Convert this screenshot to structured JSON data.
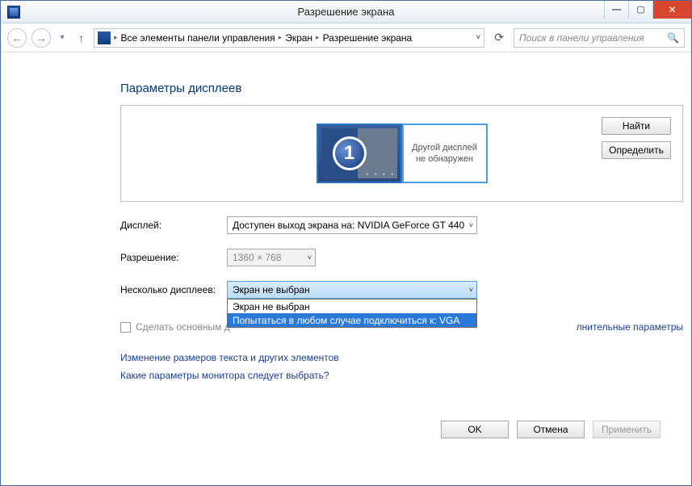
{
  "window": {
    "title": "Разрешение экрана"
  },
  "breadcrumb": {
    "root": "Все элементы панели управления",
    "mid": "Экран",
    "leaf": "Разрешение экрана"
  },
  "search": {
    "placeholder": "Поиск в панели управления"
  },
  "page": {
    "heading": "Параметры дисплеев",
    "monitor_number": "1",
    "second_monitor_msg": "Другой дисплей не обнаружен",
    "find_btn": "Найти",
    "identify_btn": "Определить"
  },
  "fields": {
    "display_label": "Дисплей:",
    "display_value": "Доступен выход экрана на: NVIDIA GeForce GT 440",
    "resolution_label": "Разрешение:",
    "resolution_value": "1360 × 768",
    "multi_label": "Несколько дисплеев:",
    "multi_value": "Экран не выбран",
    "multi_opt0": "Экран не выбран",
    "multi_opt1": "Попытаться в любом случае подключиться к: VGA",
    "make_primary": "Сделать основным д",
    "advanced": "лнительные параметры"
  },
  "links": {
    "resize": "Изменение размеров текста и других элементов",
    "which": "Какие параметры монитора следует выбрать?"
  },
  "actions": {
    "ok": "OK",
    "cancel": "Отмена",
    "apply": "Применить"
  }
}
